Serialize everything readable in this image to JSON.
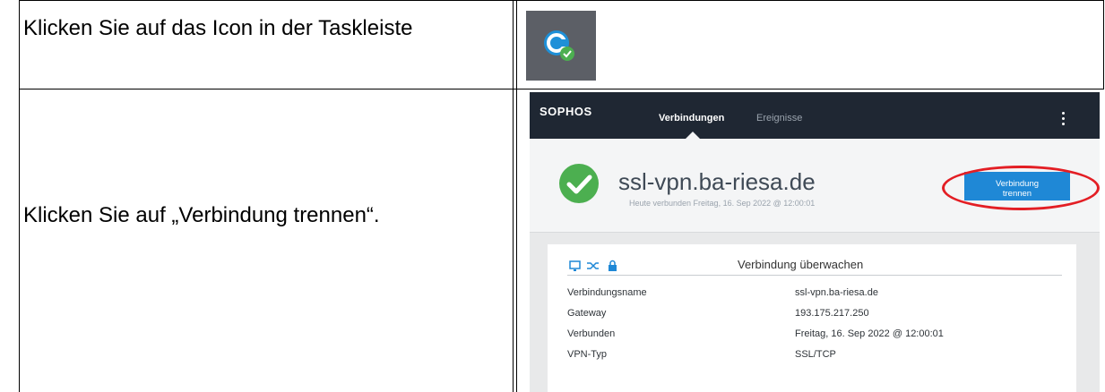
{
  "instructions": [
    "Klicken Sie auf das Icon in der Taskleiste",
    "Klicken Sie auf „Verbindung trennen“."
  ],
  "sophos": {
    "logo": "SOPHOS",
    "tabs": [
      "Verbindungen",
      "Ereignisse"
    ],
    "active_tab": "Verbindungen",
    "hostname": "ssl-vpn.ba-riesa.de",
    "status_line": "Heute verbunden Freitag, 16. Sep 2022 @ 12:00:01",
    "disconnect_button": {
      "line1": "Verbindung",
      "line2": "trennen"
    },
    "monitor_title": "Verbindung überwachen",
    "details": [
      {
        "label": "Verbindungsname",
        "value": "ssl-vpn.ba-riesa.de"
      },
      {
        "label": "Gateway",
        "value": "193.175.217.250"
      },
      {
        "label": "Verbunden",
        "value": "Freitag, 16. Sep 2022 @ 12:00:01"
      },
      {
        "label": "VPN-Typ",
        "value": "SSL/TCP"
      }
    ]
  },
  "colors": {
    "header_bg": "#1f2733",
    "button_blue": "#1f88d6",
    "success_green": "#4caf50",
    "highlight_red": "#e31e24"
  },
  "icons": [
    "sophos-connect-tray-icon",
    "green-check-icon",
    "monitor-icon",
    "shuffle-icon",
    "lock-icon",
    "more-vertical-icon"
  ]
}
